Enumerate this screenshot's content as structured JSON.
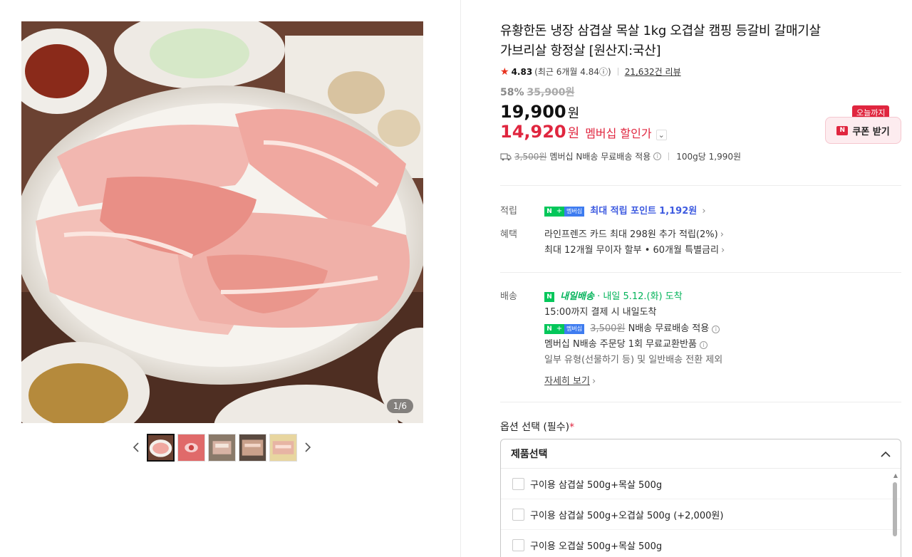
{
  "gallery": {
    "counter": "1/6",
    "thumb_count": 5
  },
  "product": {
    "title_line1": "유황한돈 냉장 삼겹살 목살 1kg 오겹살 캠핑 등갈비 갈매기살",
    "title_line2": "가브리살 항정살 [원산지:국산]",
    "rating": "4.83",
    "rating_recent": "(최근 6개월 4.84ⓘ)",
    "review_count": "21,632건 리뷰",
    "discount_pct": "58%",
    "original_price": "35,900원",
    "price": "19,900",
    "price_unit": "원",
    "member_price": "14,920",
    "member_unit": "원",
    "member_label": "멤버십 할인가",
    "ship_strike": "3,500원",
    "ship_text": "멤버십 N배송 무료배송 적용",
    "unit_price": "100g당 1,990원"
  },
  "coupon": {
    "badge": "오늘까지",
    "icon": "N",
    "label": "쿠폰 받기"
  },
  "benefits": {
    "points_label": "적립",
    "badge_n": "N",
    "badge_plus": "+",
    "badge_member": "멤버십",
    "points_text": "최대 적립 포인트",
    "points_value": "1,192원",
    "perks_label": "혜택",
    "perk1": "라인프렌즈 카드 최대 298원 추가 적립(2%)",
    "perk2": "최대 12개월 무이자 할부 • 60개월 특별금리"
  },
  "delivery": {
    "label": "배송",
    "service": "내일배송",
    "arrival": "· 내일 5.12.(화) 도착",
    "cutoff": "15:00까지 결제 시 내일도착",
    "free_strike": "3,500원",
    "free_text": "N배송 무료배송 적용",
    "exchange": "멤버십 N배송 주문당 1회 무료교환반품",
    "exclusion": "일부 유형(선물하기 등) 및 일반배송 전환 제외",
    "more_link": "자세히 보기"
  },
  "options": {
    "title": "옵션 선택 (필수)",
    "required_mark": "*",
    "select_label": "제품선택",
    "items": [
      "구이용 삼겹살 500g+목살 500g",
      "구이용 삼겹살 500g+오겹살 500g (+2,000원)",
      "구이용 오겹살 500g+목살 500g"
    ]
  },
  "colors": {
    "accent_red": "#e0263f",
    "naver_green": "#03c75a",
    "point_blue": "#3e5be0"
  },
  "icons": [
    "star-icon",
    "truck-icon",
    "info-icon",
    "chevron-left-icon",
    "chevron-right-icon",
    "chevron-up-icon",
    "coupon-n-icon"
  ]
}
